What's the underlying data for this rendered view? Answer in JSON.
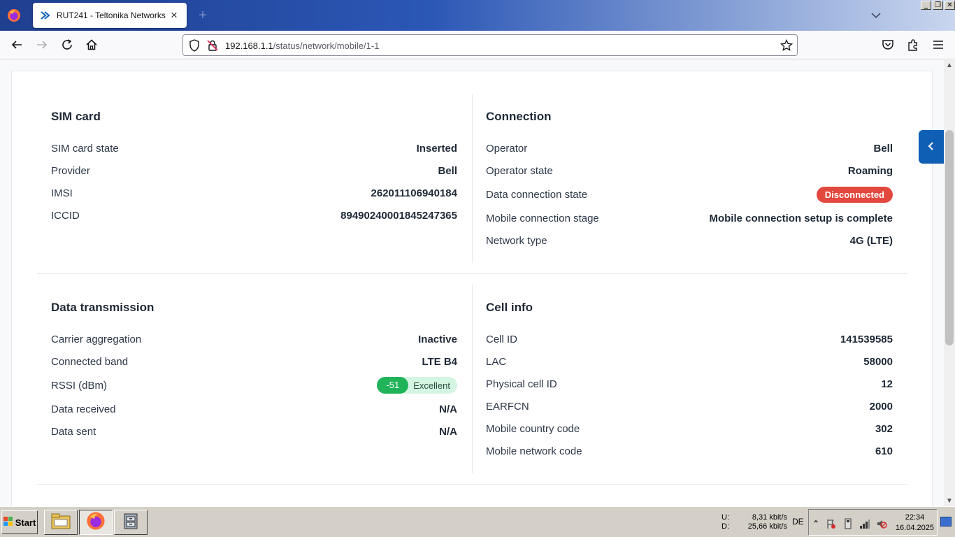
{
  "browser": {
    "tab_title": "RUT241 - Teltonika Networks",
    "url_host": "192.168.1.1",
    "url_path": "/status/network/mobile/1-1"
  },
  "window_controls": [
    "_",
    "❐",
    "✕"
  ],
  "sections": {
    "sim_card": {
      "title": "SIM card",
      "rows": [
        {
          "label": "SIM card state",
          "value": "Inserted"
        },
        {
          "label": "Provider",
          "value": "Bell"
        },
        {
          "label": "IMSI",
          "value": "262011106940184"
        },
        {
          "label": "ICCID",
          "value": "89490240001845247365"
        }
      ]
    },
    "connection": {
      "title": "Connection",
      "rows": [
        {
          "label": "Operator",
          "value": "Bell"
        },
        {
          "label": "Operator state",
          "value": "Roaming"
        },
        {
          "label": "Data connection state",
          "value": "Disconnected"
        },
        {
          "label": "Mobile connection stage",
          "value": "Mobile connection setup is complete"
        },
        {
          "label": "Network type",
          "value": "4G (LTE)"
        }
      ]
    },
    "data_transmission": {
      "title": "Data transmission",
      "rows": [
        {
          "label": "Carrier aggregation",
          "value": "Inactive"
        },
        {
          "label": "Connected band",
          "value": "LTE B4"
        },
        {
          "label": "RSSI (dBm)",
          "value": "-51",
          "quality": "Excellent"
        },
        {
          "label": "Data received",
          "value": "N/A"
        },
        {
          "label": "Data sent",
          "value": "N/A"
        }
      ]
    },
    "cell_info": {
      "title": "Cell info",
      "rows": [
        {
          "label": "Cell ID",
          "value": "141539585"
        },
        {
          "label": "LAC",
          "value": "58000"
        },
        {
          "label": "Physical cell ID",
          "value": "12"
        },
        {
          "label": "EARFCN",
          "value": "2000"
        },
        {
          "label": "Mobile country code",
          "value": "302"
        },
        {
          "label": "Mobile network code",
          "value": "610"
        }
      ]
    }
  },
  "colors": {
    "badge_disconnected": "#e2483d",
    "rssi_good": "#21b35a",
    "side_tab": "#0f5fb4"
  },
  "taskbar": {
    "start_label": "Start",
    "net_up_label": "U:",
    "net_down_label": "D:",
    "net_up_value": "8,31 kbit/s",
    "net_down_value": "25,66 kbit/s",
    "language": "DE",
    "time": "22:34",
    "date": "16.04.2025"
  }
}
